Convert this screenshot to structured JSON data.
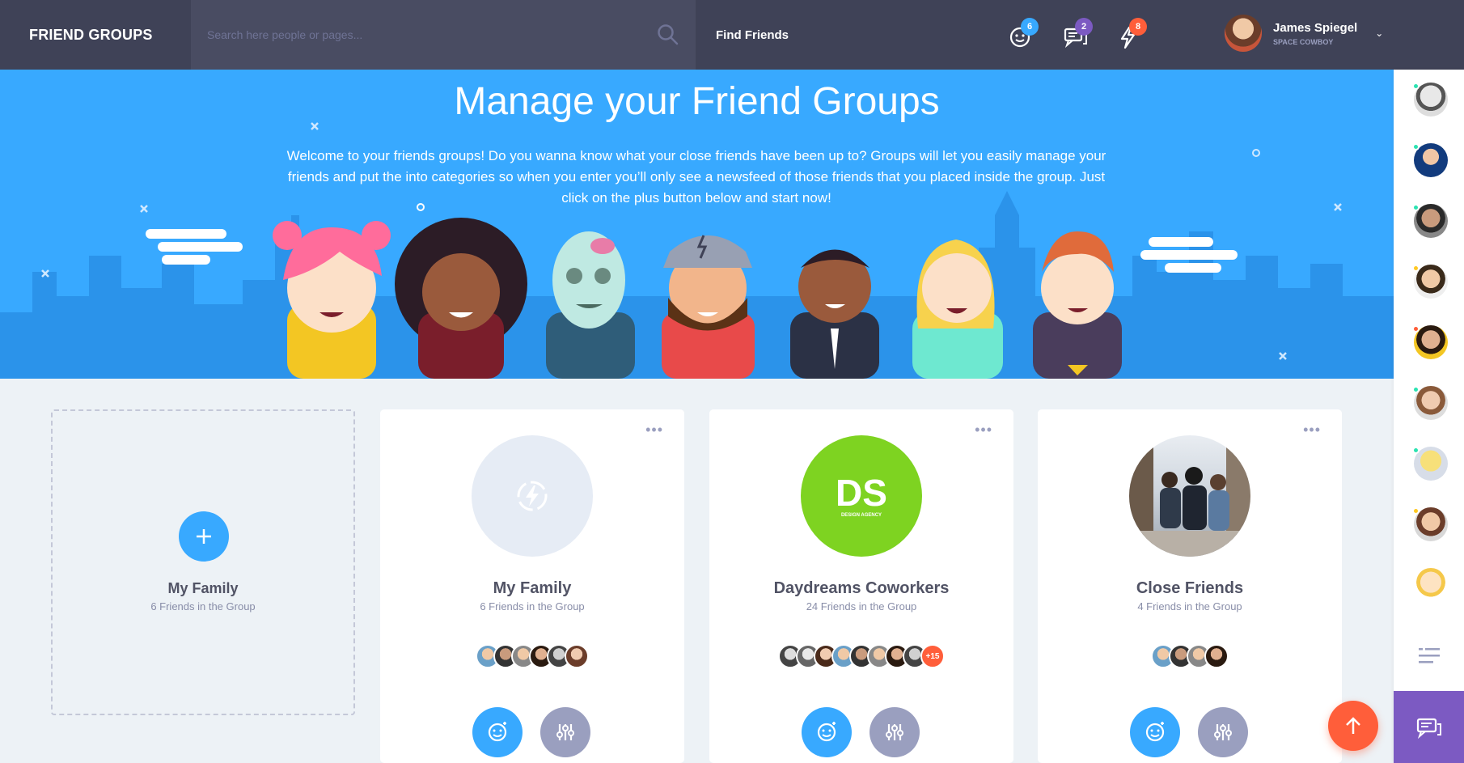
{
  "header": {
    "brand": "FRIEND GROUPS",
    "search_placeholder": "Search here people or pages...",
    "find_friends": "Find Friends",
    "notifications": [
      {
        "icon": "smiley-icon",
        "count": "6",
        "color": "#38a9ff"
      },
      {
        "icon": "chat-icon",
        "count": "2",
        "color": "#7c5ac2"
      },
      {
        "icon": "bolt-icon",
        "count": "8",
        "color": "#ff5e3a"
      }
    ],
    "user": {
      "name": "James Spiegel",
      "tagline": "SPACE COWBOY"
    }
  },
  "hero": {
    "title": "Manage your Friend Groups",
    "text": "Welcome to your friends groups! Do you wanna know what your close friends have been up to? Groups will let you easily manage your friends and put the into categories so when you enter you’ll only see a newsfeed of those friends that you placed inside the group. Just click on the plus button below and start now!"
  },
  "add_card": {
    "title": "My Family",
    "subtitle": "6 Friends in the Group"
  },
  "groups": [
    {
      "title": "My Family",
      "subtitle": "6 Friends in the Group",
      "more": ""
    },
    {
      "title": "Daydreams Coworkers",
      "subtitle": "24 Friends in the Group",
      "logo": "DS",
      "logo_sub": "DESIGN AGENCY",
      "more": "+15"
    },
    {
      "title": "Close Friends",
      "subtitle": "4 Friends in the Group",
      "more": ""
    }
  ],
  "colors": {
    "accent_blue": "#38a9ff",
    "accent_orange": "#ff5e3a",
    "accent_purple": "#7c5ac2",
    "header": "#3f4257",
    "ds_green": "#7ed321"
  }
}
